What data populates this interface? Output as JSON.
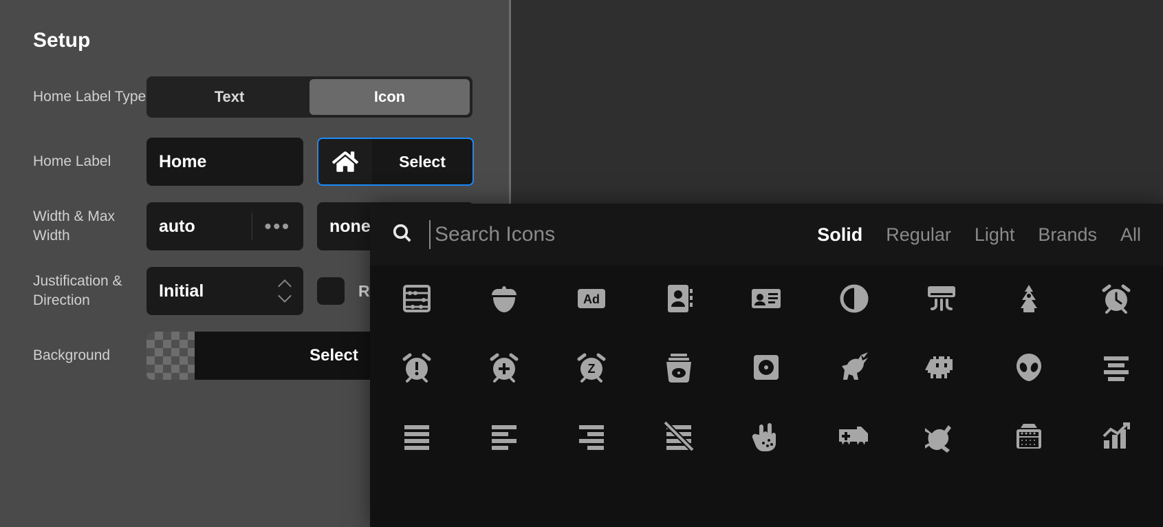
{
  "panel": {
    "title": "Setup",
    "labels": {
      "homeLabelType": "Home Label Type",
      "homeLabel": "Home Label",
      "widthMax": "Width & Max Width",
      "justification": "Justification & Direction",
      "background": "Background"
    },
    "homeLabelType": {
      "options": [
        "Text",
        "Icon"
      ],
      "selected": "Icon"
    },
    "homeLabel": {
      "value": "Home",
      "selectButton": "Select",
      "currentIcon": "home-icon"
    },
    "width": {
      "value": "auto",
      "max": "none"
    },
    "justification": {
      "value": "Initial",
      "reverseLabel": "R",
      "reverseChecked": false
    },
    "background": {
      "selectLabel": "Select"
    }
  },
  "iconPicker": {
    "searchPlaceholder": "Search Icons",
    "filters": [
      "Solid",
      "Regular",
      "Light",
      "Brands",
      "All"
    ],
    "activeFilter": "Solid",
    "icons": [
      "abacus-icon",
      "acorn-icon",
      "ad-icon",
      "address-book-icon",
      "address-card-icon",
      "adjust-icon",
      "air-conditioner-icon",
      "air-freshener-icon",
      "alarm-clock-icon",
      "alarm-exclamation-icon",
      "alarm-plus-icon",
      "alarm-snooze-icon",
      "album-collection-icon",
      "album-icon",
      "alicorn-icon",
      "alien-monster-icon",
      "alien-icon",
      "align-center-icon",
      "align-justify-icon",
      "align-left-icon",
      "align-right-icon",
      "align-slash-icon",
      "allergies-icon",
      "ambulance-icon",
      "asl-interpreting-icon",
      "amp-guitar-icon",
      "analytics-icon"
    ]
  }
}
